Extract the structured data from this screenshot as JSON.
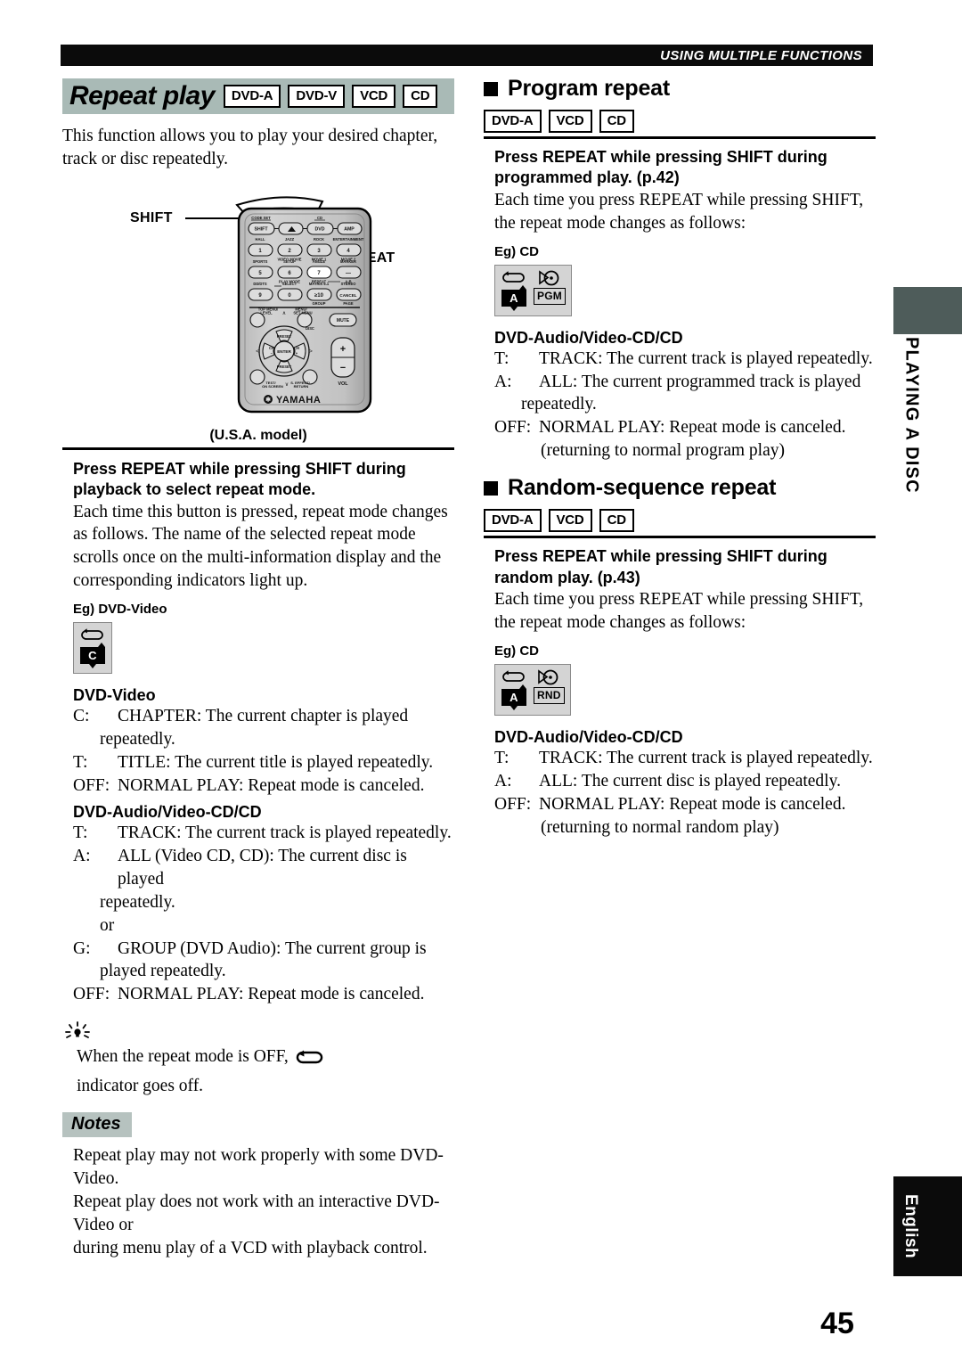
{
  "header": {
    "running_head": "USING MULTIPLE FUNCTIONS"
  },
  "page": {
    "number": "45",
    "language_tab": "English",
    "section_tab": "PLAYING A DISC"
  },
  "colors": {
    "title_band": "#a9bab6",
    "notes_tag": "#b6c2bf",
    "side_tab": "#4e5c5a",
    "header_bar": "#0b0b0b",
    "display_box": "#d4d4d4"
  },
  "left_column": {
    "title": "Repeat play",
    "disc_badges": [
      "DVD-A",
      "DVD-V",
      "VCD",
      "CD"
    ],
    "intro": "This function allows you to play your desired chapter, track or disc repeatedly.",
    "figure": {
      "callout_shift": "SHIFT",
      "callout_repeat": "REPEAT",
      "caption": "(U.S.A. model)",
      "remote_brand": "YAMAHA",
      "remote_buttons": {
        "row_top": [
          "SHIFT",
          "OPEN/CLOSE",
          "DVD",
          "AMP"
        ],
        "row_top_sublabels": [
          "CODE SET",
          "",
          "CD",
          ""
        ],
        "numeric": [
          "1",
          "2",
          "3",
          "4",
          "5",
          "6",
          "7",
          "—",
          "9",
          "0",
          "≥10",
          "CANCEL"
        ],
        "numeric_sublabels": [
          "HALL",
          "JAZZ",
          "ROCK",
          "ENTERTAINMENT",
          "SPORTS",
          "VIDEO MOVIE",
          "MOVIE 1",
          "MOVIE 2",
          "DD/DTS",
          "SELECT",
          "MATRIX 6.1",
          "STEREO"
        ],
        "numeric_sublabels2": [
          "",
          "SETUP",
          "ANGLE",
          "MARKER",
          "",
          "PLAY MODE",
          "REPEAT",
          "A-B",
          "",
          "",
          "GROUP",
          "PAGE"
        ],
        "nav": [
          "TOP MENU/LEVEL",
          "MENU/SET MENU",
          "MUTE",
          "PRESET",
          "CH −",
          "ENTER",
          "CH +",
          "PRESET",
          "TEST/ON SCREEN",
          "S. EFFECT/RETURN",
          "VOL"
        ]
      }
    },
    "instruction": {
      "heading": "Press REPEAT while pressing SHIFT during playback to select repeat mode.",
      "body": "Each time this button is pressed, repeat mode changes as follows. The name of the selected repeat mode scrolls once on the multi-information display and the corresponding indicators light up."
    },
    "example": {
      "label": "Eg) DVD-Video",
      "indicator_tag": "C"
    },
    "dvd_video": {
      "heading": "DVD-Video",
      "rows": [
        {
          "key": "C:",
          "text": "CHAPTER: The current chapter is played",
          "cont": "repeatedly."
        },
        {
          "key": "T:",
          "text": "TITLE: The current title is played repeatedly.",
          "cont": ""
        },
        {
          "key": "OFF:",
          "text": "NORMAL PLAY: Repeat mode is canceled.",
          "cont": ""
        }
      ]
    },
    "dvd_audio": {
      "heading": "DVD-Audio/Video-CD/CD",
      "rows": [
        {
          "key": "T:",
          "text": "TRACK: The current track is played repeatedly.",
          "cont": ""
        },
        {
          "key": "A:",
          "text": "ALL (Video CD, CD): The current disc is played",
          "cont": "repeatedly."
        },
        {
          "key": "",
          "text": "",
          "cont": "or"
        },
        {
          "key": "G:",
          "text": "GROUP (DVD Audio): The current group is",
          "cont": "played repeatedly."
        },
        {
          "key": "OFF:",
          "text": "NORMAL PLAY: Repeat mode is canceled.",
          "cont": ""
        }
      ]
    },
    "tip": {
      "text_before": "When the repeat mode is OFF,",
      "text_after": "indicator goes off."
    },
    "notes": {
      "label": "Notes",
      "lines": [
        "Repeat play may not work properly with some DVD-Video.",
        "Repeat play does not work with an interactive DVD-Video or",
        "during menu play of a VCD with playback control."
      ]
    }
  },
  "right_column": {
    "program_repeat": {
      "title": "Program repeat",
      "disc_badges": [
        "DVD-A",
        "VCD",
        "CD"
      ],
      "instruction_heading": "Press REPEAT while pressing SHIFT during programmed play. (p.42)",
      "instruction_body": "Each time you press REPEAT while pressing SHIFT, the repeat mode changes as follows:",
      "example_label": "Eg) CD",
      "indicator_tag": "A",
      "mode_tag": "PGM",
      "kind_heading": "DVD-Audio/Video-CD/CD",
      "rows": [
        {
          "key": "T:",
          "text": "TRACK: The current track is played repeatedly.",
          "cont": ""
        },
        {
          "key": "A:",
          "text": "ALL: The current programmed track is played",
          "cont": "repeatedly."
        },
        {
          "key": "OFF:",
          "text": "NORMAL PLAY: Repeat mode is canceled.",
          "cont": ""
        }
      ],
      "closing_note": "(returning to normal program play)"
    },
    "random_repeat": {
      "title": "Random-sequence repeat",
      "disc_badges": [
        "DVD-A",
        "VCD",
        "CD"
      ],
      "instruction_heading": "Press REPEAT while pressing SHIFT during random play. (p.43)",
      "instruction_body": "Each time you press REPEAT while pressing SHIFT, the repeat mode changes as follows:",
      "example_label": "Eg) CD",
      "indicator_tag": "A",
      "mode_tag": "RND",
      "kind_heading": "DVD-Audio/Video-CD/CD",
      "rows": [
        {
          "key": "T:",
          "text": "TRACK: The current track is played repeatedly.",
          "cont": ""
        },
        {
          "key": "A:",
          "text": "ALL: The current disc is played repeatedly.",
          "cont": ""
        },
        {
          "key": "OFF:",
          "text": "NORMAL PLAY: Repeat mode is canceled.",
          "cont": ""
        }
      ],
      "closing_note": "(returning to normal random play)"
    }
  }
}
